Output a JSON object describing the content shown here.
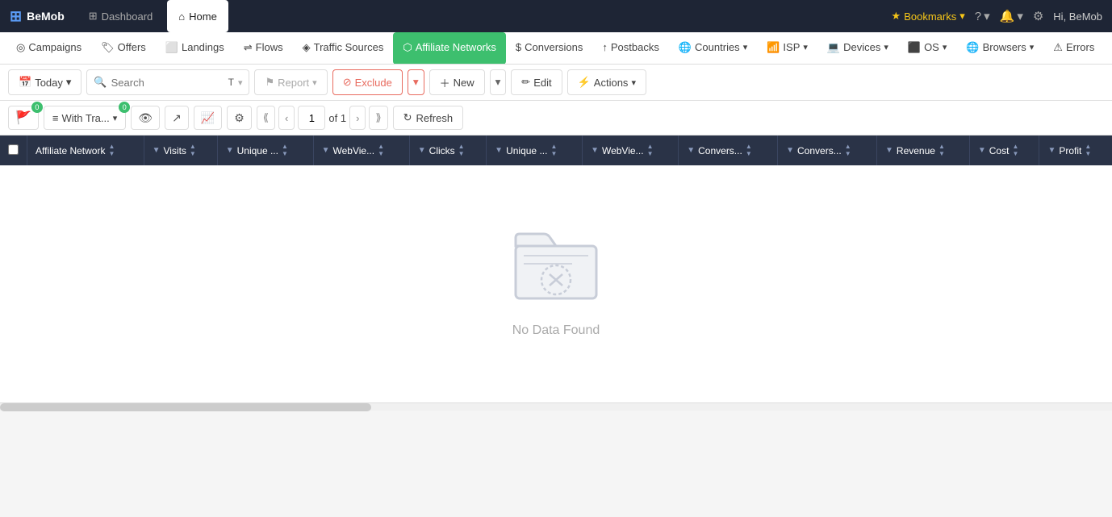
{
  "app": {
    "logo": "BeMob",
    "logo_icon": "⊞"
  },
  "topbar": {
    "tabs": [
      {
        "id": "dashboard",
        "label": "Dashboard",
        "icon": "⊞",
        "active": false
      },
      {
        "id": "home",
        "label": "Home",
        "icon": "⌂",
        "active": true
      }
    ],
    "right": {
      "bookmarks": "Bookmarks",
      "help_icon": "?",
      "notifications_icon": "🔔",
      "settings_icon": "⚙",
      "user": "Hi, BeMob"
    }
  },
  "mainnav": {
    "items": [
      {
        "id": "campaigns",
        "label": "Campaigns",
        "icon": "◎"
      },
      {
        "id": "offers",
        "label": "Offers",
        "icon": "🏷"
      },
      {
        "id": "landings",
        "label": "Landings",
        "icon": "⬜"
      },
      {
        "id": "flows",
        "label": "Flows",
        "icon": "⇌"
      },
      {
        "id": "traffic-sources",
        "label": "Traffic Sources",
        "icon": "◈"
      },
      {
        "id": "affiliate-networks",
        "label": "Affiliate Networks",
        "icon": "⬡",
        "active": true
      },
      {
        "id": "conversions",
        "label": "Conversions",
        "icon": "$"
      },
      {
        "id": "postbacks",
        "label": "Postbacks",
        "icon": "↑"
      },
      {
        "id": "countries",
        "label": "Countries",
        "icon": "🌐"
      },
      {
        "id": "isp",
        "label": "ISP",
        "icon": "📶"
      },
      {
        "id": "devices",
        "label": "Devices",
        "icon": "💻"
      },
      {
        "id": "os",
        "label": "OS",
        "icon": "⬛"
      },
      {
        "id": "browsers",
        "label": "Browsers",
        "icon": "🌐"
      },
      {
        "id": "errors",
        "label": "Errors",
        "icon": "⚠"
      }
    ]
  },
  "toolbar": {
    "today_label": "Today",
    "search_placeholder": "Search",
    "text_label": "T",
    "report_label": "Report",
    "exclude_label": "Exclude",
    "new_label": "New",
    "edit_label": "Edit",
    "actions_label": "Actions"
  },
  "toolbar2": {
    "flag_badge": "0",
    "with_tra_label": "With Tra...",
    "with_tra_badge": "0",
    "page_current": "1",
    "page_total": "of 1",
    "refresh_label": "Refresh"
  },
  "table": {
    "columns": [
      {
        "id": "affiliate-network",
        "label": "Affiliate Network"
      },
      {
        "id": "visits",
        "label": "Visits"
      },
      {
        "id": "unique",
        "label": "Unique ..."
      },
      {
        "id": "webview",
        "label": "WebVie..."
      },
      {
        "id": "clicks",
        "label": "Clicks"
      },
      {
        "id": "unique2",
        "label": "Unique ..."
      },
      {
        "id": "webview2",
        "label": "WebVie..."
      },
      {
        "id": "conversions",
        "label": "Convers..."
      },
      {
        "id": "conversions2",
        "label": "Convers..."
      },
      {
        "id": "revenue",
        "label": "Revenue"
      },
      {
        "id": "cost",
        "label": "Cost"
      },
      {
        "id": "profit",
        "label": "Profit"
      }
    ],
    "empty_label": "No Data Found"
  }
}
